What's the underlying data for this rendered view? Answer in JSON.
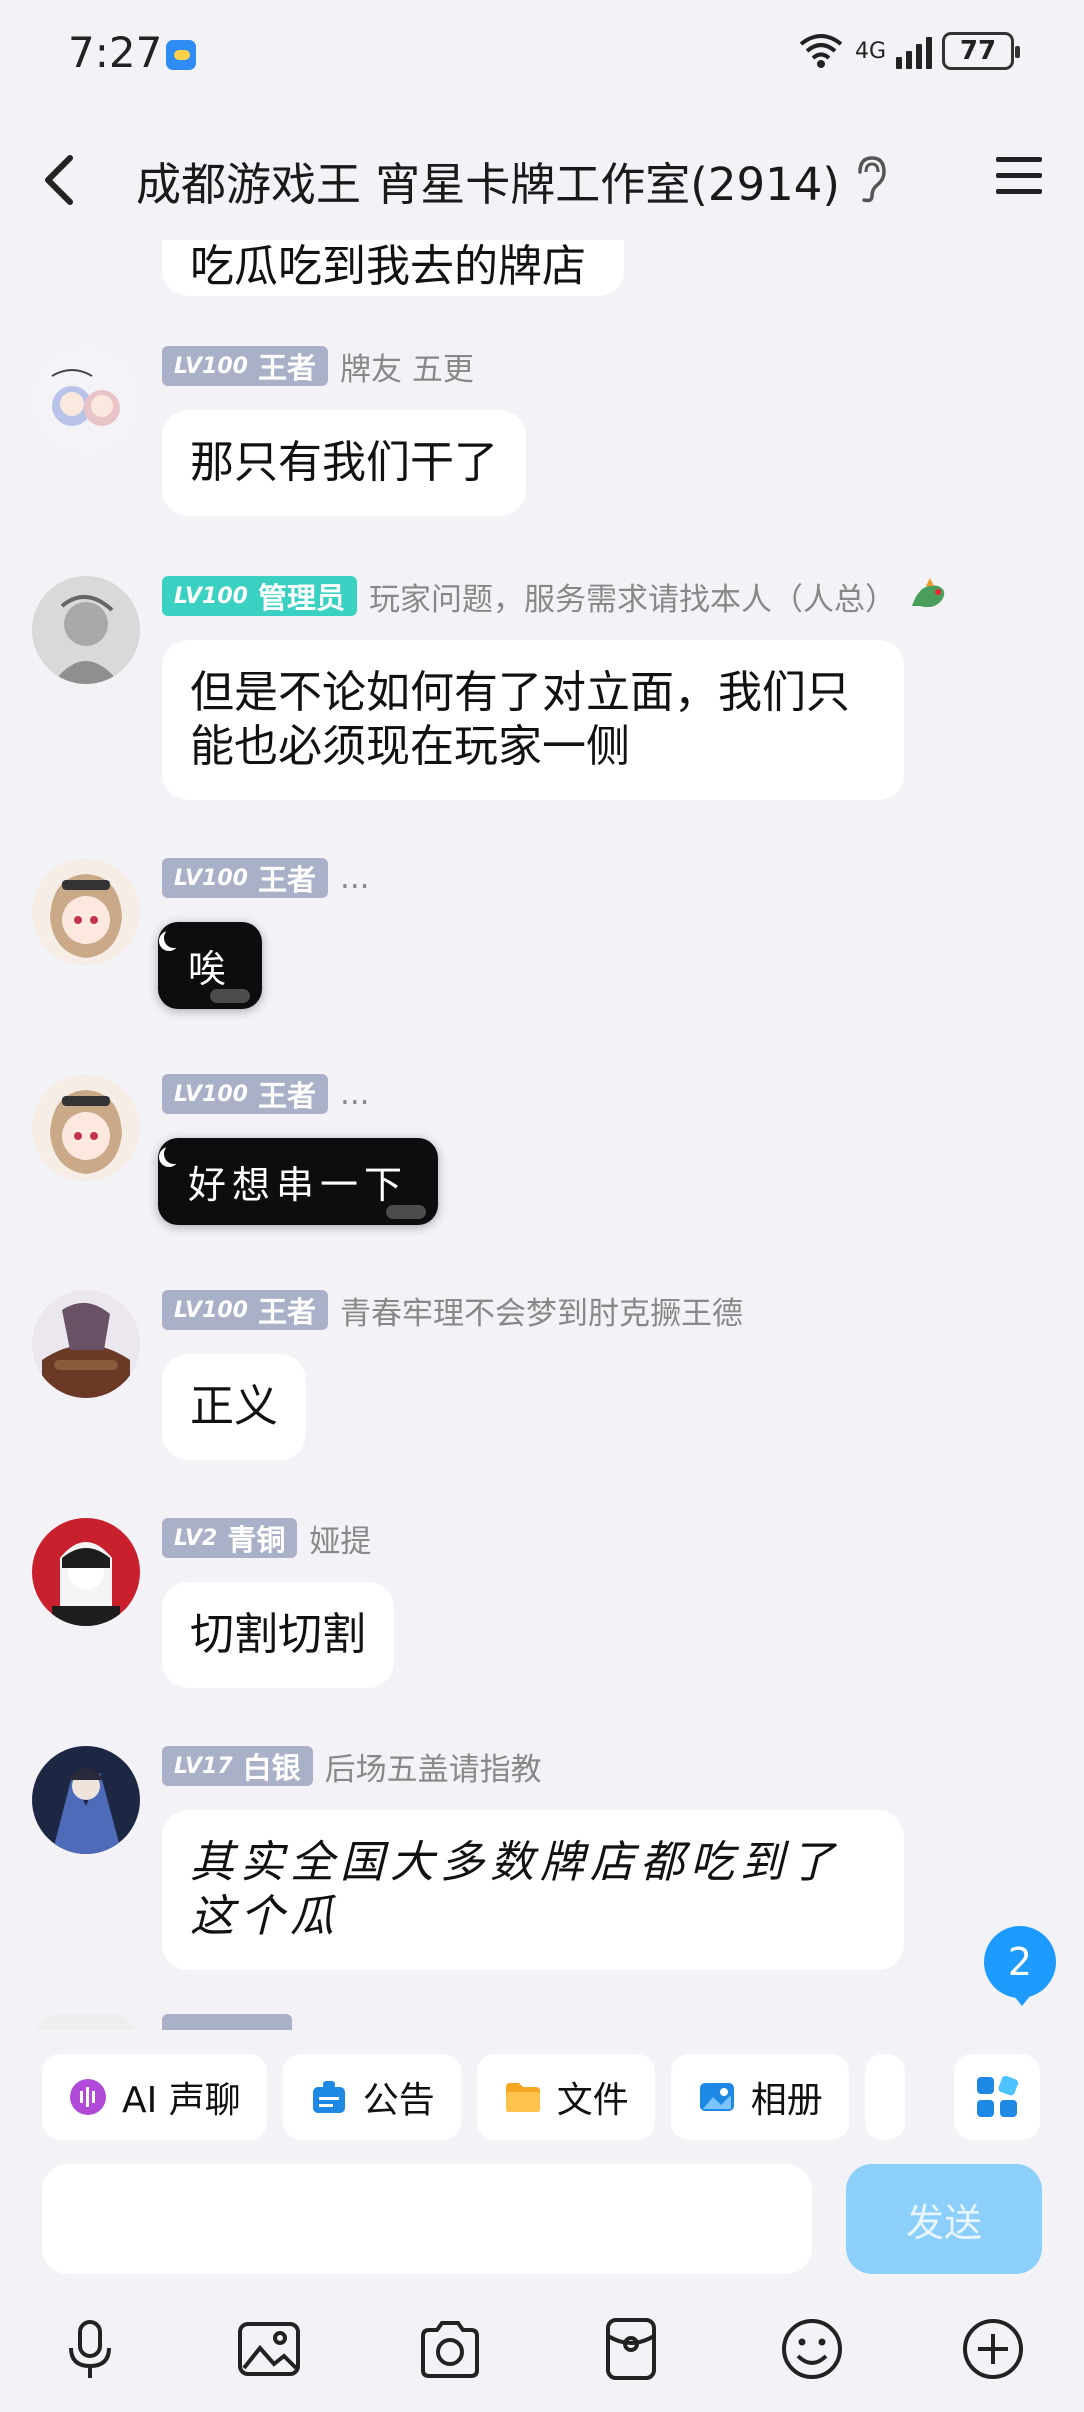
{
  "status": {
    "time": "7:27",
    "network": "4G",
    "wifi_label": "6",
    "battery": "77"
  },
  "header": {
    "title": "成都游戏王 宵星卡牌工作室(2914)"
  },
  "clipped_top_text": "吃瓜吃到我去的牌店",
  "messages": [
    {
      "rank": "LV100",
      "title": "王者",
      "nick": "牌友 五更",
      "text": "那只有我们干了",
      "style": "plain"
    },
    {
      "rank": "LV100",
      "title": "管理员",
      "nick": "玩家问题，服务需求请找本人（人总）",
      "text": "但是不论如何有了对立面，我们只能也必须现在玩家一侧",
      "style": "plain",
      "admin": true
    },
    {
      "rank": "LV100",
      "title": "王者",
      "nick": "...",
      "text": "唉",
      "style": "starry"
    },
    {
      "rank": "LV100",
      "title": "王者",
      "nick": "...",
      "text": "好想串一下",
      "style": "starry"
    },
    {
      "rank": "LV100",
      "title": "王者",
      "nick": "青春牢理不会梦到肘克撅王德",
      "text": "正义",
      "style": "plain"
    },
    {
      "rank": "LV2",
      "title": "青铜",
      "nick": "娅提",
      "text": "切割切割",
      "style": "plain"
    },
    {
      "rank": "LV17",
      "title": "白银",
      "nick": "后场五盖请指教",
      "text": "其实全国大多数牌店都吃到了这个瓜",
      "style": "hand"
    }
  ],
  "unread_count": "2",
  "quick_bar": [
    {
      "label": "AI 声聊",
      "icon": "ai-voice-icon"
    },
    {
      "label": "公告",
      "icon": "announcement-icon"
    },
    {
      "label": "文件",
      "icon": "folder-icon"
    },
    {
      "label": "相册",
      "icon": "album-icon"
    }
  ],
  "composer": {
    "placeholder": "",
    "send_label": "发送"
  },
  "colors": {
    "accent": "#1e9bff",
    "send_disabled": "#8ccffa",
    "admin_badge": "#3ad1c3",
    "rank_badge": "#a9b0c7",
    "background": "#f3f2f7"
  }
}
